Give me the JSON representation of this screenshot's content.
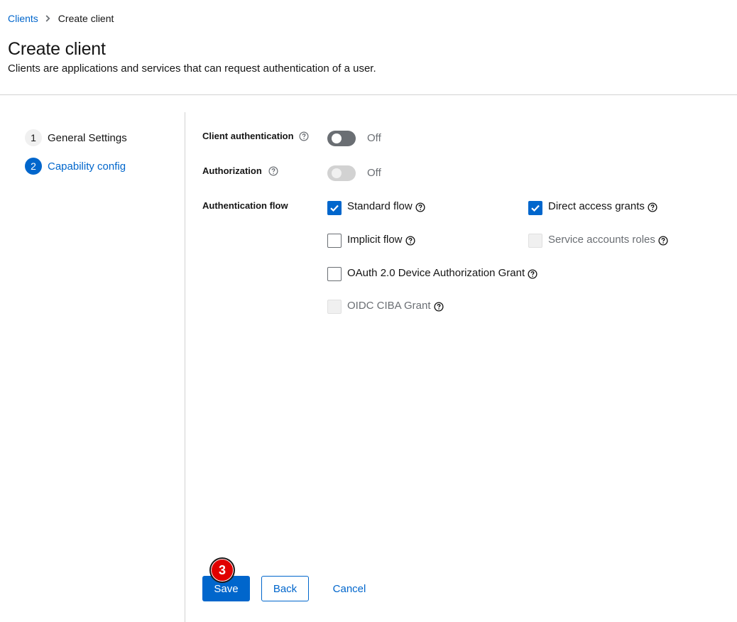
{
  "breadcrumb": {
    "parent": "Clients",
    "current": "Create client"
  },
  "header": {
    "title": "Create client",
    "description": "Clients are applications and services that can request authentication of a user."
  },
  "wizard": {
    "steps": [
      {
        "number": "1",
        "label": "General Settings",
        "state": "inactive"
      },
      {
        "number": "2",
        "label": "Capability config",
        "state": "active"
      }
    ]
  },
  "form": {
    "client_auth": {
      "label": "Client authentication",
      "value": "Off",
      "enabled": true
    },
    "authorization": {
      "label": "Authorization",
      "value": "Off",
      "enabled": false
    },
    "auth_flow": {
      "label": "Authentication flow",
      "options": {
        "standard_flow": {
          "label": "Standard flow",
          "checked": true,
          "disabled": false
        },
        "direct_access": {
          "label": "Direct access grants",
          "checked": true,
          "disabled": false
        },
        "implicit_flow": {
          "label": "Implicit flow",
          "checked": false,
          "disabled": false
        },
        "service_accounts": {
          "label": "Service accounts roles",
          "checked": false,
          "disabled": true
        },
        "device_grant": {
          "label": "OAuth 2.0 Device Authorization Grant",
          "checked": false,
          "disabled": false
        },
        "ciba_grant": {
          "label": "OIDC CIBA Grant",
          "checked": false,
          "disabled": true
        }
      }
    }
  },
  "actions": {
    "save": "Save",
    "back": "Back",
    "cancel": "Cancel"
  },
  "annotation": {
    "marker": "3"
  },
  "colors": {
    "accent": "#0066cc",
    "text": "#151515",
    "muted": "#6a6e73",
    "marker": "#e00000"
  }
}
